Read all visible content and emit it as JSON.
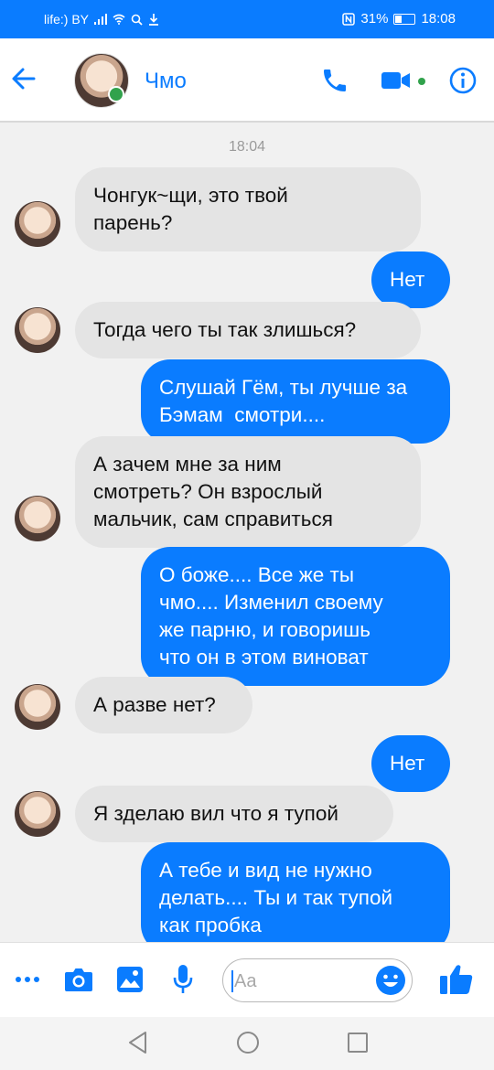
{
  "status_bar": {
    "carrier": "life:) BY",
    "battery": "31%",
    "time": "18:08"
  },
  "header": {
    "contact_name": "Чмо"
  },
  "chat": {
    "timestamp": "18:04",
    "messages": [
      {
        "direction": "in",
        "lines": [
          "Чонгук~щи, это твой",
          "парень?"
        ]
      },
      {
        "direction": "out",
        "lines": [
          "Нет"
        ]
      },
      {
        "direction": "in",
        "lines": [
          "Тогда чего ты так злишься?"
        ]
      },
      {
        "direction": "out",
        "lines": [
          "Слушай Гём, ты лучше за",
          "Бэмам  смотри...."
        ]
      },
      {
        "direction": "in",
        "lines": [
          "А зачем мне за ним",
          "смотреть? Он взрослый",
          "мальчик, сам справиться"
        ]
      },
      {
        "direction": "out",
        "lines": [
          "О боже.... Все же ты",
          "чмо.... Изменил своему",
          "же парню, и говоришь",
          "что он в этом виноват"
        ]
      },
      {
        "direction": "in",
        "lines": [
          "А разве нет?"
        ]
      },
      {
        "direction": "out",
        "lines": [
          "Нет"
        ]
      },
      {
        "direction": "in",
        "lines": [
          "Я зделаю вил что я тупой"
        ]
      },
      {
        "direction": "out",
        "lines": [
          "А тебе и вид не нужно",
          "делать.... Ты и так тупой",
          "как пробка"
        ]
      }
    ]
  },
  "composer": {
    "placeholder": "Aa"
  },
  "colors": {
    "accent": "#0a7cff",
    "incoming_bubble": "#e4e4e4",
    "online": "#31a24c",
    "background": "#f1f1f1"
  },
  "icons": [
    "back-arrow-icon",
    "phone-icon",
    "video-camera-icon",
    "info-icon",
    "more-icon",
    "camera-icon",
    "image-icon",
    "microphone-icon",
    "emoji-icon",
    "thumbs-up-icon",
    "nav-back-icon",
    "nav-home-icon",
    "nav-recents-icon"
  ]
}
